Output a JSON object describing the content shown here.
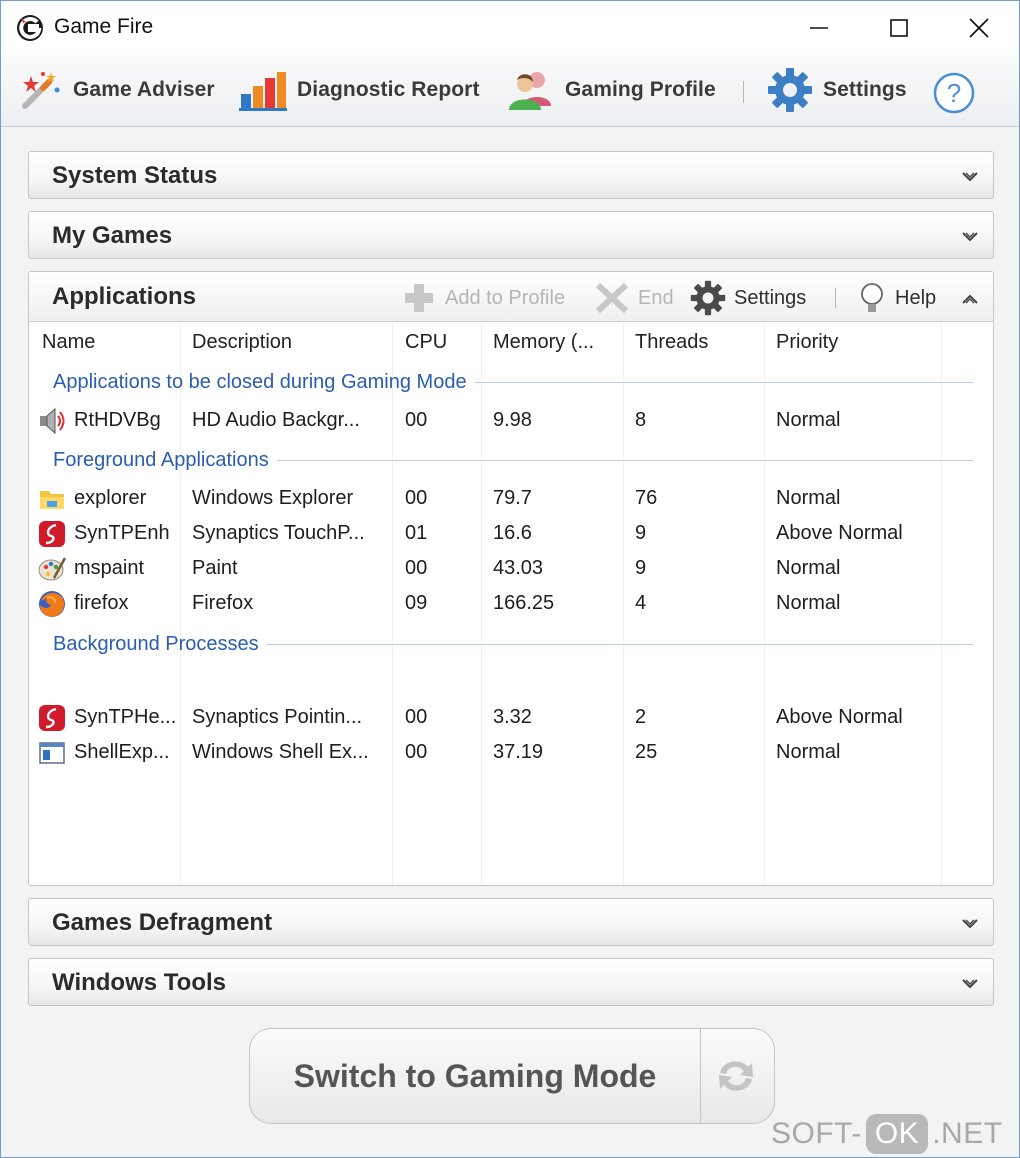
{
  "window": {
    "title": "Game Fire"
  },
  "toolbar": {
    "game_adviser": "Game Adviser",
    "diagnostic_report": "Diagnostic Report",
    "gaming_profile": "Gaming Profile",
    "settings": "Settings"
  },
  "panels": {
    "system_status": "System Status",
    "my_games": "My Games",
    "applications": "Applications",
    "games_defragment": "Games Defragment",
    "windows_tools": "Windows Tools"
  },
  "app_toolbar": {
    "add_to_profile": "Add to Profile",
    "end": "End",
    "settings": "Settings",
    "help": "Help"
  },
  "table": {
    "columns": [
      "Name",
      "Description",
      "CPU",
      "Memory (...",
      "Threads",
      "Priority"
    ],
    "groups": [
      {
        "title": "Applications to be closed during Gaming Mode",
        "rows": [
          {
            "icon": "speaker-icon",
            "name": "RtHDVBg",
            "description": "HD Audio Backgr...",
            "cpu": "00",
            "memory": "9.98",
            "threads": "8",
            "priority": "Normal"
          }
        ]
      },
      {
        "title": "Foreground Applications",
        "rows": [
          {
            "icon": "folder-icon",
            "name": "explorer",
            "description": "Windows Explorer",
            "cpu": "00",
            "memory": "79.7",
            "threads": "76",
            "priority": "Normal"
          },
          {
            "icon": "synaptics-icon",
            "name": "SynTPEnh",
            "description": "Synaptics TouchP...",
            "cpu": "01",
            "memory": "16.6",
            "threads": "9",
            "priority": "Above Normal"
          },
          {
            "icon": "paint-icon",
            "name": "mspaint",
            "description": "Paint",
            "cpu": "00",
            "memory": "43.03",
            "threads": "9",
            "priority": "Normal"
          },
          {
            "icon": "firefox-icon",
            "name": "firefox",
            "description": "Firefox",
            "cpu": "09",
            "memory": "166.25",
            "threads": "4",
            "priority": "Normal"
          }
        ]
      },
      {
        "title": "Background Processes",
        "rows": [
          {
            "icon": "synaptics-icon",
            "name": "SynTPHe...",
            "description": "Synaptics Pointin...",
            "cpu": "00",
            "memory": "3.32",
            "threads": "2",
            "priority": "Above Normal"
          },
          {
            "icon": "shell-icon",
            "name": "ShellExp...",
            "description": "Windows Shell Ex...",
            "cpu": "00",
            "memory": "37.19",
            "threads": "25",
            "priority": "Normal"
          }
        ]
      }
    ]
  },
  "gaming_mode_button": "Switch to Gaming Mode",
  "watermark": {
    "left": "SOFT-",
    "mid": "OK",
    "right": ".NET"
  },
  "colors": {
    "group_text": "#2a5db0",
    "accent_blue": "#2e78c6",
    "logo_red": "#d32f2f"
  }
}
